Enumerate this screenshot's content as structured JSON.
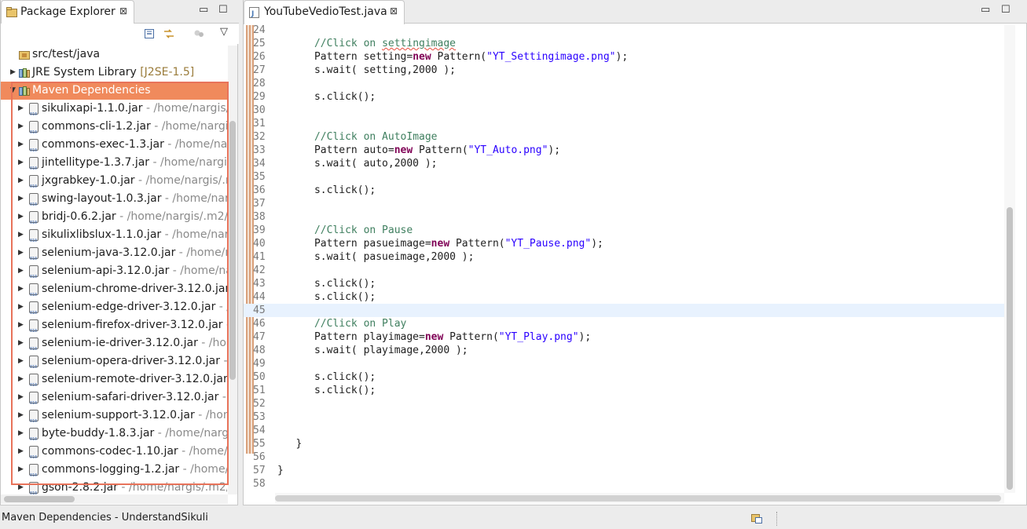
{
  "package_explorer": {
    "tab_label": "Package Explorer",
    "close_glyph": "⊠",
    "minimize_glyph": "▭",
    "maximize_glyph": "☐",
    "menu_glyph": "▽",
    "tree": [
      {
        "label": "src/test/java",
        "suffix": "",
        "icon": "package-folder-icon",
        "expanded": null
      },
      {
        "label": "JRE System Library",
        "suffix": " [J2SE-1.5]",
        "icon": "library-icon",
        "expanded": false
      },
      {
        "label": "Maven Dependencies",
        "suffix": "",
        "icon": "library-icon",
        "expanded": true,
        "selected": true
      },
      {
        "label": "sikulixapi-1.1.0.jar",
        "suffix": " - /home/nargis/.m",
        "icon": "jar-icon",
        "expanded": false
      },
      {
        "label": "commons-cli-1.2.jar",
        "suffix": " - /home/nargis/.m",
        "icon": "jar-icon",
        "expanded": false
      },
      {
        "label": "commons-exec-1.3.jar",
        "suffix": " - /home/narg",
        "icon": "jar-icon",
        "expanded": false
      },
      {
        "label": "jintellitype-1.3.7.jar",
        "suffix": " - /home/nargis/",
        "icon": "jar-icon",
        "expanded": false
      },
      {
        "label": "jxgrabkey-1.0.jar",
        "suffix": " - /home/nargis/.m",
        "icon": "jar-icon",
        "expanded": false
      },
      {
        "label": "swing-layout-1.0.3.jar",
        "suffix": " - /home/nargis",
        "icon": "jar-icon",
        "expanded": false
      },
      {
        "label": "bridj-0.6.2.jar",
        "suffix": " - /home/nargis/.m2/re",
        "icon": "jar-icon",
        "expanded": false
      },
      {
        "label": "sikulixlibslux-1.1.0.jar",
        "suffix": " - /home/nargi",
        "icon": "jar-icon",
        "expanded": false
      },
      {
        "label": "selenium-java-3.12.0.jar",
        "suffix": " - /home/nar",
        "icon": "jar-icon",
        "expanded": false
      },
      {
        "label": "selenium-api-3.12.0.jar",
        "suffix": " - /home/nar",
        "icon": "jar-icon",
        "expanded": false
      },
      {
        "label": "selenium-chrome-driver-3.12.0.jar",
        "suffix": " - /",
        "icon": "jar-icon",
        "expanded": false
      },
      {
        "label": "selenium-edge-driver-3.12.0.jar",
        "suffix": " - /ho",
        "icon": "jar-icon",
        "expanded": false
      },
      {
        "label": "selenium-firefox-driver-3.12.0.jar",
        "suffix": " - /",
        "icon": "jar-icon",
        "expanded": false
      },
      {
        "label": "selenium-ie-driver-3.12.0.jar",
        "suffix": " - /home",
        "icon": "jar-icon",
        "expanded": false
      },
      {
        "label": "selenium-opera-driver-3.12.0.jar",
        "suffix": " - /h",
        "icon": "jar-icon",
        "expanded": false
      },
      {
        "label": "selenium-remote-driver-3.12.0.jar",
        "suffix": " - /h",
        "icon": "jar-icon",
        "expanded": false
      },
      {
        "label": "selenium-safari-driver-3.12.0.jar",
        "suffix": " - /h",
        "icon": "jar-icon",
        "expanded": false
      },
      {
        "label": "selenium-support-3.12.0.jar",
        "suffix": " - /home",
        "icon": "jar-icon",
        "expanded": false
      },
      {
        "label": "byte-buddy-1.8.3.jar",
        "suffix": " - /home/nargis/",
        "icon": "jar-icon",
        "expanded": false
      },
      {
        "label": "commons-codec-1.10.jar",
        "suffix": " - /home/na",
        "icon": "jar-icon",
        "expanded": false
      },
      {
        "label": "commons-logging-1.2.jar",
        "suffix": " - /home/na",
        "icon": "jar-icon",
        "expanded": false
      },
      {
        "label": "gson-2.8.2.jar",
        "suffix": " - /home/nargis/.m2/re",
        "icon": "jar-icon",
        "expanded": false
      }
    ]
  },
  "editor": {
    "tab_label": "YouTubeVedioTest.java",
    "close_glyph": "⊠",
    "current_line": 45,
    "lines": [
      {
        "n": "24",
        "t": [
          [
            "",
            "                    "
          ]
        ]
      },
      {
        "n": "25",
        "t": [
          [
            "",
            "      "
          ],
          [
            "cm",
            "//Click on "
          ],
          [
            "cm squig",
            "settingimage"
          ]
        ]
      },
      {
        "n": "26",
        "t": [
          [
            "",
            "      Pattern setting="
          ],
          [
            "kw",
            "new"
          ],
          [
            "",
            " Pattern("
          ],
          [
            "st",
            "\"YT_Settingimage.png\""
          ],
          [
            "",
            ");"
          ]
        ]
      },
      {
        "n": "27",
        "t": [
          [
            "",
            "      s.wait( setting,2000 );"
          ]
        ]
      },
      {
        "n": "28",
        "t": [
          [
            "",
            ""
          ]
        ]
      },
      {
        "n": "29",
        "t": [
          [
            "",
            "      s.click();"
          ]
        ]
      },
      {
        "n": "30",
        "t": [
          [
            "",
            ""
          ]
        ]
      },
      {
        "n": "31",
        "t": [
          [
            "",
            ""
          ]
        ]
      },
      {
        "n": "32",
        "t": [
          [
            "",
            "      "
          ],
          [
            "cm",
            "//Click on AutoImage"
          ]
        ]
      },
      {
        "n": "33",
        "t": [
          [
            "",
            "      Pattern auto="
          ],
          [
            "kw",
            "new"
          ],
          [
            "",
            " Pattern("
          ],
          [
            "st",
            "\"YT_Auto.png\""
          ],
          [
            "",
            ");"
          ]
        ]
      },
      {
        "n": "34",
        "t": [
          [
            "",
            "      s.wait( auto,2000 );"
          ]
        ]
      },
      {
        "n": "35",
        "t": [
          [
            "",
            ""
          ]
        ]
      },
      {
        "n": "36",
        "t": [
          [
            "",
            "      s.click();"
          ]
        ]
      },
      {
        "n": "37",
        "t": [
          [
            "",
            ""
          ]
        ]
      },
      {
        "n": "38",
        "t": [
          [
            "",
            ""
          ]
        ]
      },
      {
        "n": "39",
        "t": [
          [
            "",
            "      "
          ],
          [
            "cm",
            "//Click on Pause"
          ]
        ]
      },
      {
        "n": "40",
        "t": [
          [
            "",
            "      Pattern pasueimage="
          ],
          [
            "kw",
            "new"
          ],
          [
            "",
            " Pattern("
          ],
          [
            "st",
            "\"YT_Pause.png\""
          ],
          [
            "",
            ");"
          ]
        ]
      },
      {
        "n": "41",
        "t": [
          [
            "",
            "      s.wait( pasueimage,2000 );"
          ]
        ]
      },
      {
        "n": "42",
        "t": [
          [
            "",
            ""
          ]
        ]
      },
      {
        "n": "43",
        "t": [
          [
            "",
            "      s.click();"
          ]
        ]
      },
      {
        "n": "44",
        "t": [
          [
            "",
            "      s.click();"
          ]
        ]
      },
      {
        "n": "45",
        "t": [
          [
            "",
            ""
          ]
        ]
      },
      {
        "n": "46",
        "t": [
          [
            "",
            "      "
          ],
          [
            "cm",
            "//Click on Play"
          ]
        ]
      },
      {
        "n": "47",
        "t": [
          [
            "",
            "      Pattern playimage="
          ],
          [
            "kw",
            "new"
          ],
          [
            "",
            " Pattern("
          ],
          [
            "st",
            "\"YT_Play.png\""
          ],
          [
            "",
            ");"
          ]
        ]
      },
      {
        "n": "48",
        "t": [
          [
            "",
            "      s.wait( playimage,2000 );"
          ]
        ]
      },
      {
        "n": "49",
        "t": [
          [
            "",
            ""
          ]
        ]
      },
      {
        "n": "50",
        "t": [
          [
            "",
            "      s.click();"
          ]
        ]
      },
      {
        "n": "51",
        "t": [
          [
            "",
            "      s.click();"
          ]
        ]
      },
      {
        "n": "52",
        "t": [
          [
            "",
            ""
          ]
        ]
      },
      {
        "n": "53",
        "t": [
          [
            "",
            ""
          ]
        ]
      },
      {
        "n": "54",
        "t": [
          [
            "",
            ""
          ]
        ]
      },
      {
        "n": "55",
        "t": [
          [
            "",
            "   }"
          ]
        ]
      },
      {
        "n": "56",
        "t": [
          [
            "",
            ""
          ]
        ]
      },
      {
        "n": "57",
        "t": [
          [
            "",
            "}"
          ]
        ]
      },
      {
        "n": "58",
        "t": [
          [
            "",
            ""
          ]
        ]
      }
    ]
  },
  "status_bar": {
    "text": "Maven Dependencies - UnderstandSikuli"
  },
  "colors": {
    "selection": "#f08a5c",
    "highlight_box": "#e8735a",
    "comment": "#3f7f5f",
    "keyword": "#7f0055",
    "string": "#2a00ff"
  }
}
